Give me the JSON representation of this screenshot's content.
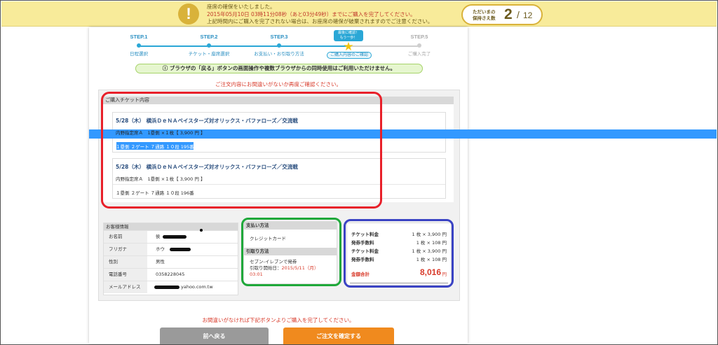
{
  "alert": {
    "line1": "座席の確保をいたしました。",
    "line2": "2015年05月10日 03時11分08秒（あと03分49秒）までにご購入を完了してください。",
    "line3": "上記時間内にご購入を完了されない場合は、お座席の確保が破棄されますのでご注意ください。",
    "icon": "exclamation-icon"
  },
  "counter": {
    "label_line1": "ただいまの",
    "label_line2": "保持さえ数",
    "current": "2",
    "sep": "/",
    "max": "12"
  },
  "steps": [
    {
      "num": "STEP.1",
      "name": "日程選択"
    },
    {
      "num": "STEP.2",
      "name": "チケット・座席選択"
    },
    {
      "num": "STEP.3",
      "name": "お支払い・お引取り方法"
    },
    {
      "num": "",
      "name": "ご購入内容のご確認"
    },
    {
      "num": "STEP.5",
      "name": "ご購入完了"
    }
  ],
  "step_bubble": {
    "line1": "最後に確認！",
    "line2": "もう一歩！"
  },
  "warning": "ⓘ ブラウザの「戻る」ボタンの画面操作や複数ブラウザからの同時使用はご利用いただけません。",
  "confirm_text": "ご注文内容にお間違いがないか再度ご確認ください。",
  "tickets": {
    "header": "ご購入チケット内容",
    "items": [
      {
        "title": "5/28（木） 横浜ＤｅＮＡベイスターズ対オリックス・バファローズ／交流戦",
        "line1": "内野指定席Ａ　1塁側 ×１枚【 3,900 円 】",
        "line2": "１塁側 ２ゲート ７通路 １０段 195番"
      },
      {
        "title": "5/28（木） 横浜ＤｅＮＡベイスターズ対オリックス・バファローズ／交流戦",
        "line1": "内野指定席Ａ　1塁側 ×１枚【 3,900 円 】",
        "line2": "１塁側 ２ゲート ７通路 １０段 196番"
      }
    ]
  },
  "customer": {
    "header": "お客様情報",
    "rows": [
      {
        "key": "お名前",
        "val": "侯"
      },
      {
        "key": "フリガナ",
        "val": "ホウ"
      },
      {
        "key": "性別",
        "val": "男性"
      },
      {
        "key": "電話番号",
        "val": "0358228045"
      },
      {
        "key": "メールアドレス",
        "val": "yahoo.com.tw"
      }
    ]
  },
  "payment": {
    "header": "支払い方法",
    "value": "クレジットカード",
    "pickup_header": "引取り方法",
    "pickup_line1": "セブン-イレブンで発券",
    "pickup_line2_label": "引取り開始日：",
    "pickup_line2_date": "2015/5/11（月）",
    "pickup_line3": "03:01"
  },
  "price": {
    "rows": [
      {
        "key": "チケット料金",
        "val": "1 枚 × 3,900 円"
      },
      {
        "key": "発券手数料",
        "val": "1 枚 × 108 円"
      },
      {
        "key": "チケット料金",
        "val": "1 枚 × 3,900 円"
      },
      {
        "key": "発券手数料",
        "val": "1 枚 × 108 円"
      }
    ],
    "total_label": "金額合計",
    "total_value": "8,016",
    "total_unit": "円"
  },
  "bottom_note": "お間違いがなければ下記ボタンよりご購入を完了してください。",
  "buttons": {
    "back": "前へ戻る",
    "confirm": "ご注文を確定する"
  },
  "colors": {
    "accent": "#2aa7d6",
    "warning_red": "#d83a2a",
    "confirm_orange": "#f08a1e",
    "annotation_red": "#e8202a",
    "annotation_green": "#1fa83a",
    "annotation_blue": "#3a43c4"
  }
}
